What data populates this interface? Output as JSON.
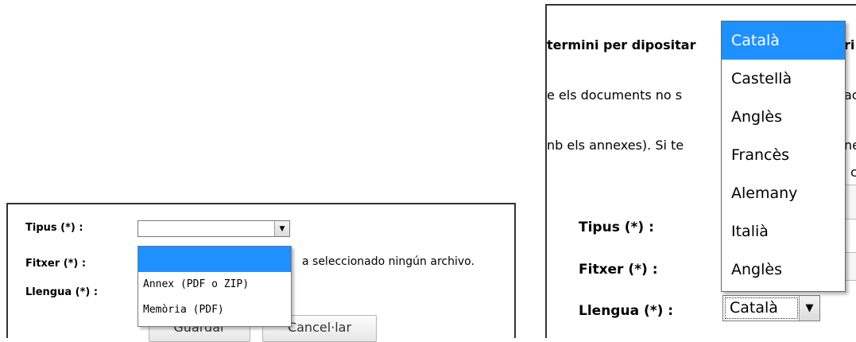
{
  "left": {
    "tipus_label": "Tipus (*) :",
    "fitxer_label": "Fitxer (*) :",
    "llengua_label": "Llengua (*) :",
    "tipus_value": "",
    "tipus_options": [
      "",
      "Annex (PDF o ZIP)",
      "Memòria (PDF)"
    ],
    "file_status": "a seleccionado ningún archivo.",
    "save_button": "Guardar",
    "cancel_button": "Cancel·lar"
  },
  "right": {
    "text_line1": "termini per dipositar",
    "text_line1_tail": "ri",
    "text_line2": "e els documents no s",
    "text_line2_tail": "ac",
    "text_line3": "nb els annexes). Si te",
    "text_line3_tail": "ne",
    "text_line3b_tail": "c",
    "tipus_label": "Tipus (*) :",
    "fitxer_label": "Fitxer (*) :",
    "llengua_label": "Llengua (*) :",
    "llengua_value": "Català",
    "llengua_options": [
      "Català",
      "Castellà",
      "Anglès",
      "Francès",
      "Alemany",
      "Italià",
      "Anglès"
    ]
  },
  "icons": {
    "dropdown_arrow": "▼"
  },
  "colors": {
    "selection": "#1e90ff"
  }
}
